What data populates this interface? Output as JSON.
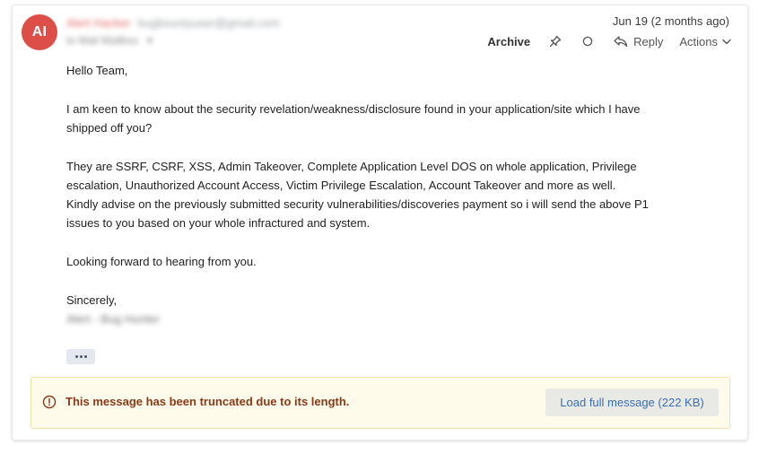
{
  "message": {
    "avatar_initials": "AI",
    "sender_name": "Alert Hacker",
    "sender_email": "bugbountyuser@gmail.com",
    "to_line": "to Mail Mailbox",
    "date": "Jun 19 (2 months ago)"
  },
  "toolbar": {
    "archive_label": "Archive",
    "reply_label": "Reply",
    "actions_label": "Actions"
  },
  "body": {
    "greeting": "Hello Team,",
    "para1": "I am keen to know about the security revelation/weakness/disclosure found in your application/site which I have shipped off you?",
    "para2a": "They are SSRF, CSRF, XSS, Admin Takeover, Complete Application Level DOS on whole application, Privilege escalation, Unauthorized Account Access, Victim Privilege Escalation, Account Takeover and more as well.",
    "para2b": "Kindly advise on the previously submitted security vulnerabilities/discoveries payment so i will send the above P1 issues to you based on your whole infractured and system.",
    "para3": "Looking forward to hearing from you.",
    "closing": "Sincerely,",
    "signature": "Alert - Bug Hunter"
  },
  "banner": {
    "message": "This message has been truncated due to its length.",
    "load_button": "Load full message (222 KB)"
  },
  "colors": {
    "avatar_bg": "#dc4e47",
    "banner_bg": "#fffbea",
    "banner_text": "#8a3a18",
    "link_blue": "#3a6fb0"
  }
}
